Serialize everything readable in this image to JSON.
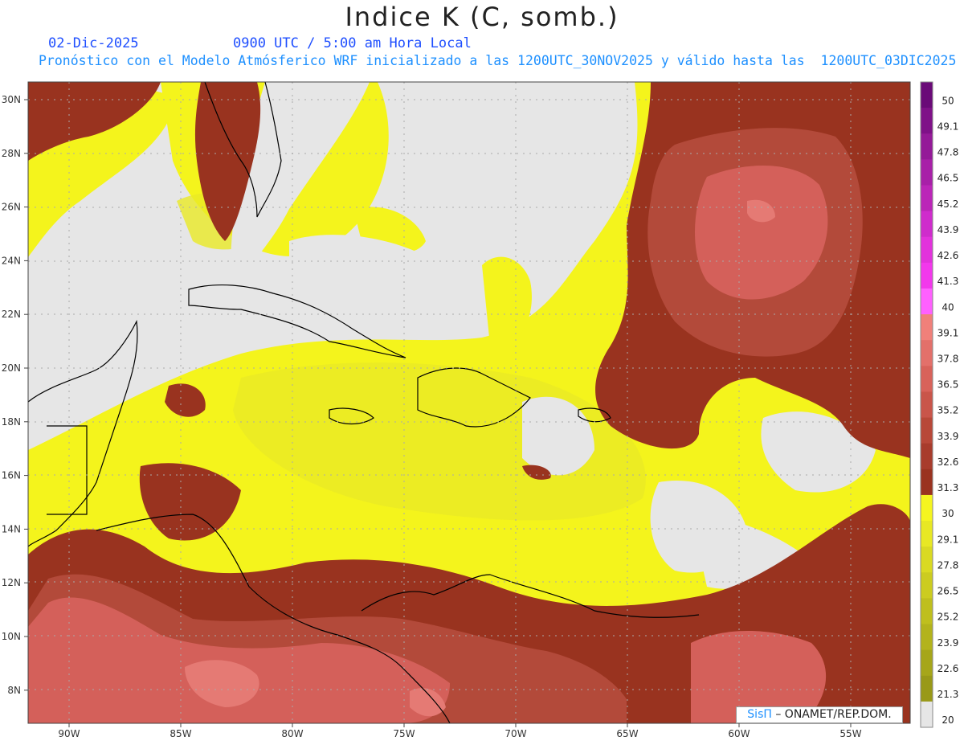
{
  "header": {
    "title": "Indice K (C, somb.)",
    "date": "02-Dic-2025",
    "valid_time": "0900 UTC / 5:00 am Hora Local",
    "description": "Pronóstico con el Modelo Atmósferico WRF inicializado a las 1200UTC_30NOV2025 y válido hasta las  1200UTC_03DIC2025"
  },
  "map": {
    "lat_labels": [
      "30N",
      "28N",
      "26N",
      "24N",
      "22N",
      "20N",
      "18N",
      "16N",
      "14N",
      "12N",
      "10N",
      "8N"
    ],
    "lon_labels": [
      "90W",
      "85W",
      "80W",
      "75W",
      "70W",
      "65W",
      "60W",
      "55W"
    ],
    "colors": {
      "low": "#e6e6e6",
      "yellow": "#f4f41c",
      "yellow_light": "#eaea26",
      "yellow_dark": "#c8c81c",
      "brown": "#99331f",
      "brown_mid": "#b34a3a",
      "salmon": "#d4605a",
      "pink": "#e57a74",
      "coast": "#000000",
      "grid": "#aaaaaa"
    }
  },
  "colorbar": {
    "labels": [
      "50",
      "49.1",
      "47.8",
      "46.5",
      "45.2",
      "43.9",
      "42.6",
      "41.3",
      "40",
      "39.1",
      "37.8",
      "36.5",
      "35.2",
      "33.9",
      "32.6",
      "31.3",
      "30",
      "29.1",
      "27.8",
      "26.5",
      "25.2",
      "23.9",
      "22.6",
      "21.3",
      "20"
    ],
    "colors": [
      "#6a0a78",
      "#7f1188",
      "#941a98",
      "#a820a8",
      "#bb26b8",
      "#cf2ccc",
      "#e232dc",
      "#f238ec",
      "#ff60ff",
      "#f0807a",
      "#e3706a",
      "#d8625a",
      "#c9554a",
      "#b84838",
      "#a83c2c",
      "#9a3320",
      "#f5f520",
      "#e8e824",
      "#dada22",
      "#cccc20",
      "#bfbf1e",
      "#b3b31c",
      "#a6a61a",
      "#999918",
      "#e6e6e6"
    ]
  },
  "credit": {
    "brand": "SisΠ",
    "text": "– ONAMET/REP.DOM."
  }
}
